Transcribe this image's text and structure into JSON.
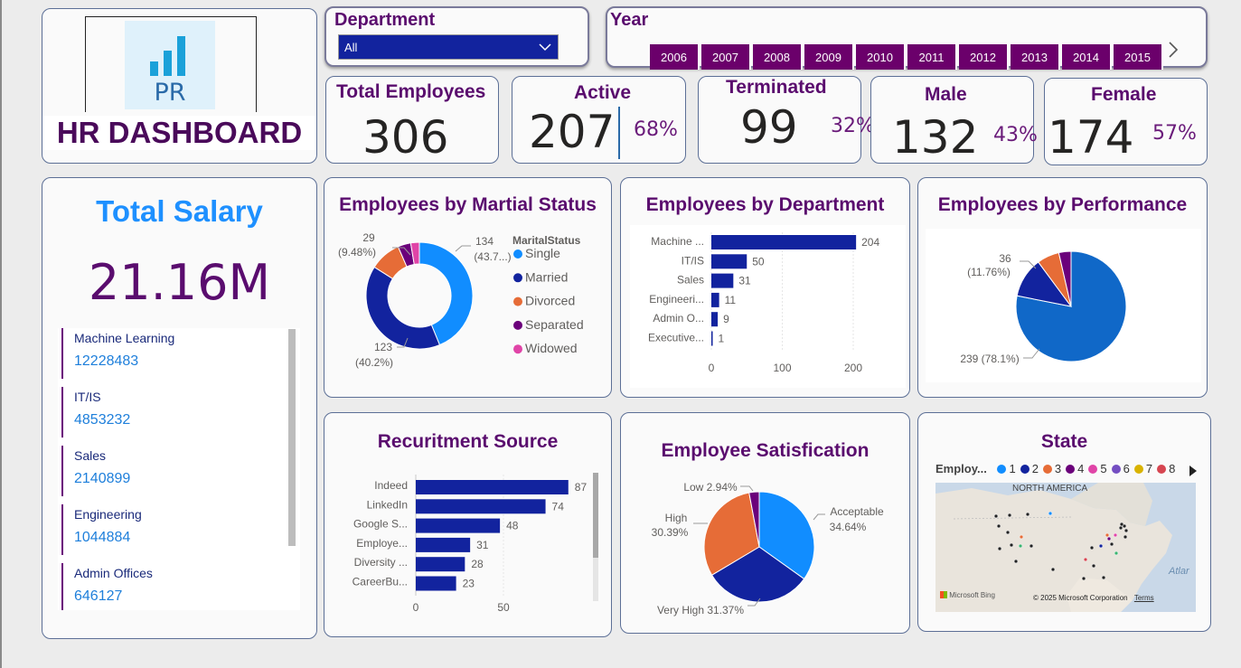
{
  "logo": {
    "mark": "PR",
    "title": "HR DASHBOARD"
  },
  "department_filter": {
    "label": "Department",
    "value": "All"
  },
  "year_filter": {
    "label": "Year",
    "years": [
      "2006",
      "2007",
      "2008",
      "2009",
      "2010",
      "2011",
      "2012",
      "2013",
      "2014",
      "2015"
    ]
  },
  "kpis": {
    "total": {
      "label": "Total Employees",
      "value": "306"
    },
    "active": {
      "label": "Active",
      "value": "207",
      "pct": "68%"
    },
    "terminated": {
      "label": "Terminated",
      "value": "99",
      "pct": "32%"
    },
    "male": {
      "label": "Male",
      "value": "132",
      "pct": "43%"
    },
    "female": {
      "label": "Female",
      "value": "174",
      "pct": "57%"
    }
  },
  "salary": {
    "label": "Total Salary",
    "value": "21.16M",
    "items": [
      {
        "name": "Machine Learning",
        "value": "12228483"
      },
      {
        "name": "IT/IS",
        "value": "4853232"
      },
      {
        "name": "Sales",
        "value": "2140899"
      },
      {
        "name": "Engineering",
        "value": "1044884"
      },
      {
        "name": "Admin Offices",
        "value": "646127"
      }
    ]
  },
  "colors": {
    "blue_light": "#118dff",
    "navy": "#12239e",
    "orange": "#e66c37",
    "purple": "#6b007b",
    "pink": "#e044a7",
    "violet": "#744ec2",
    "gold": "#d9b300",
    "red": "#d64550",
    "title": "#5a0c6e"
  },
  "marital": {
    "title": "Employees by Martial Status",
    "legend_title": "MaritalStatus",
    "legend": [
      "Single",
      "Married",
      "Divorced",
      "Separated",
      "Widowed"
    ],
    "labels": {
      "single": "134",
      "single_pct": "(43.7...)",
      "married": "123",
      "married_pct": "(40.2%)",
      "divorced": "29",
      "divorced_pct": "(9.48%)"
    }
  },
  "department_chart": {
    "title": "Employees by Department",
    "categories": [
      "Machine ...",
      "IT/IS",
      "Sales",
      "Engineeri...",
      "Admin O...",
      "Executive..."
    ],
    "values": [
      204,
      50,
      31,
      11,
      9,
      1
    ],
    "ticks": [
      "0",
      "100",
      "200"
    ]
  },
  "performance": {
    "title": "Employees by Performance",
    "label_a": "36",
    "label_a_pct": "(11.76%)",
    "label_b": "239 (78.1%)"
  },
  "recruitment": {
    "title": "Recuritment Source",
    "categories": [
      "Indeed",
      "LinkedIn",
      "Google S...",
      "Employe...",
      "Diversity ...",
      "CareerBu..."
    ],
    "values": [
      87,
      74,
      48,
      31,
      28,
      23
    ],
    "ticks": [
      "0",
      "50"
    ]
  },
  "satisfaction": {
    "title": "Employee Satisfication",
    "labels": {
      "low": "Low 2.94%",
      "high": "High",
      "high_pct": "30.39%",
      "acceptable": "Acceptable",
      "acceptable_pct": "34.64%",
      "very_high": "Very High 31.37%"
    }
  },
  "state": {
    "title": "State",
    "legend_title": "Employ...",
    "legend": [
      "1",
      "2",
      "3",
      "4",
      "5",
      "6",
      "7",
      "8"
    ],
    "map_label": "NORTH AMERICA",
    "ocean_label": "Atlar",
    "bing": "Microsoft Bing",
    "copyright": "© 2025 Microsoft Corporation",
    "terms": "Terms"
  },
  "chart_data": [
    {
      "type": "pie",
      "title": "Employees by Martial Status",
      "categories": [
        "Single",
        "Married",
        "Divorced",
        "Separated",
        "Widowed"
      ],
      "values": [
        134,
        123,
        29,
        12,
        8
      ]
    },
    {
      "type": "bar",
      "title": "Employees by Department",
      "categories": [
        "Machine ...",
        "IT/IS",
        "Sales",
        "Engineeri...",
        "Admin O...",
        "Executive..."
      ],
      "values": [
        204,
        50,
        31,
        11,
        9,
        1
      ],
      "xlim": [
        0,
        210
      ]
    },
    {
      "type": "pie",
      "title": "Employees by Performance",
      "values": [
        239,
        36,
        20,
        11
      ]
    },
    {
      "type": "bar",
      "title": "Recuritment Source",
      "categories": [
        "Indeed",
        "LinkedIn",
        "Google S...",
        "Employe...",
        "Diversity ...",
        "CareerBu..."
      ],
      "values": [
        87,
        74,
        48,
        31,
        28,
        23
      ],
      "xlim": [
        0,
        90
      ]
    },
    {
      "type": "pie",
      "title": "Employee Satisfication",
      "categories": [
        "Acceptable",
        "Very High",
        "High",
        "Low"
      ],
      "values": [
        34.64,
        31.37,
        30.39,
        2.94
      ]
    }
  ]
}
